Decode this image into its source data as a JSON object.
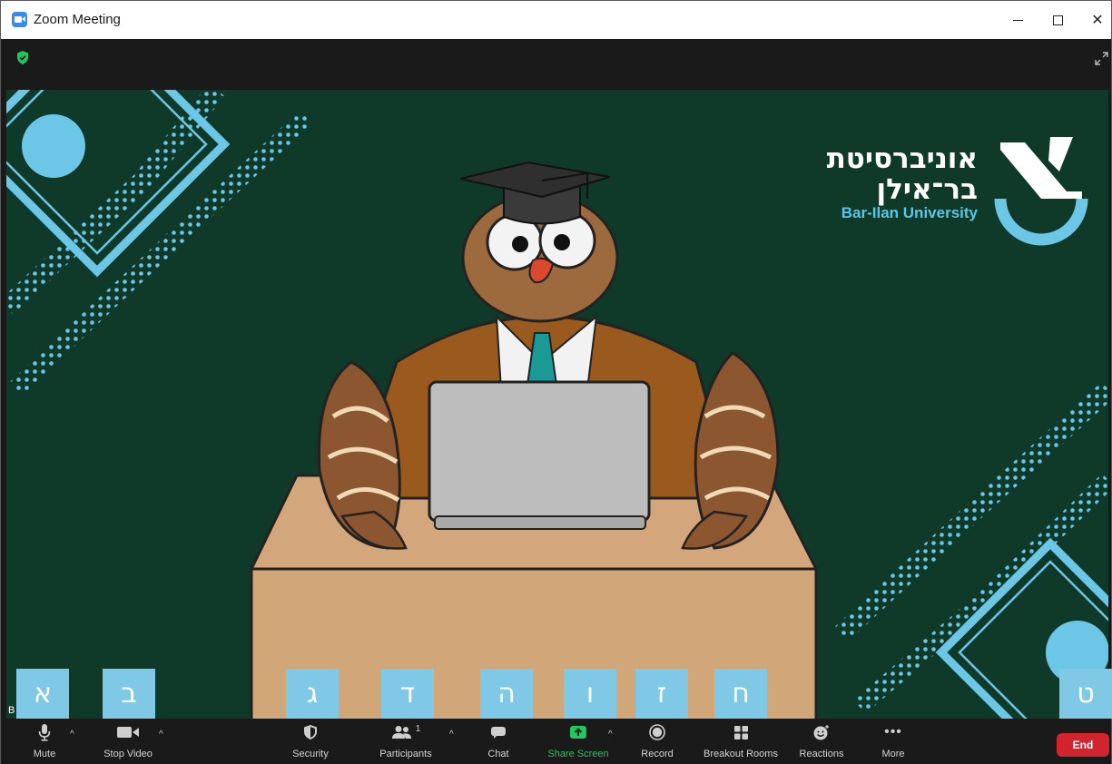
{
  "window": {
    "title": "Zoom Meeting"
  },
  "video": {
    "logo_hebrew_line1": "אוניברסיטת",
    "logo_hebrew_line2": "בר־אילן",
    "logo_english": "Bar-Ilan University",
    "participant_name_initial": "B"
  },
  "letters": [
    "א",
    "ב",
    "ג",
    "ד",
    "ה",
    "ו",
    "ז",
    "ח",
    "ט"
  ],
  "toolbar": {
    "mute": "Mute",
    "stop_video": "Stop Video",
    "security": "Security",
    "participants": "Participants",
    "participants_count": "1",
    "chat": "Chat",
    "share_screen": "Share Screen",
    "record": "Record",
    "breakout_rooms": "Breakout Rooms",
    "reactions": "Reactions",
    "more": "More",
    "end": "End"
  },
  "colors": {
    "video_bg": "#0f3a2a",
    "accent_blue": "#5bc6e8",
    "share_green": "#22c55e",
    "end_red": "#d1242f",
    "letter_box": "#7fc8e6"
  }
}
